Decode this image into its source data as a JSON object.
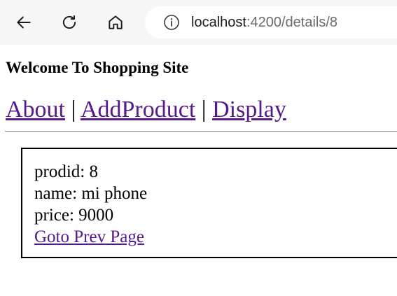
{
  "browser": {
    "url_host": "localhost",
    "url_path": ":4200/details/8",
    "icons": [
      "back-arrow-icon",
      "reload-icon",
      "home-icon",
      "info-icon"
    ]
  },
  "site": {
    "title": "Welcome To Shopping Site",
    "nav": {
      "about": "About",
      "add_product": "AddProduct",
      "display": "Display",
      "separator": "|"
    }
  },
  "product": {
    "prodid_line": "prodid: 8",
    "name_line": "name: mi phone",
    "price_line": "price: 9000",
    "prev_link": "Goto Prev Page"
  },
  "colors": {
    "link_visited": "#551a8b",
    "toolbar_bg": "#f7f7f7"
  }
}
